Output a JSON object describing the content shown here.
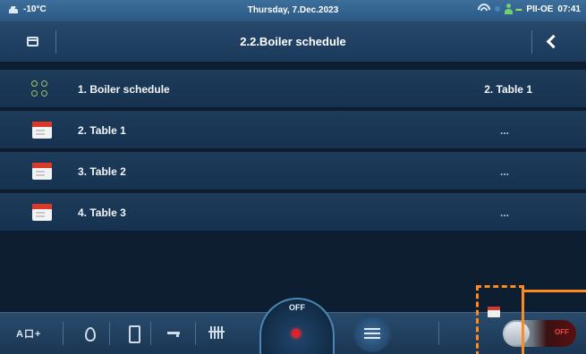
{
  "status": {
    "outside_temp": "-10°C",
    "date": "Thursday, 7.Dec.2023",
    "device": "PII-OE",
    "time": "07:41"
  },
  "header": {
    "title": "2.2.Boiler schedule"
  },
  "rows": [
    {
      "label": "1.  Boiler schedule",
      "value": "2. Table 1",
      "icon": "schedule-dots-icon"
    },
    {
      "label": "2.  Table 1",
      "value": "...",
      "icon": "calendar-icon"
    },
    {
      "label": "3.  Table 2",
      "value": "...",
      "icon": "calendar-icon"
    },
    {
      "label": "4.  Table 3",
      "value": "...",
      "icon": "calendar-icon"
    }
  ],
  "bottom_bar": {
    "mode_label": "A口+",
    "off_label": "OFF",
    "toggle_label": "OFF"
  },
  "colors": {
    "accent_blue": "#2b5883",
    "record_red": "#e0202a",
    "annotation_orange": "#ff8a1f"
  }
}
